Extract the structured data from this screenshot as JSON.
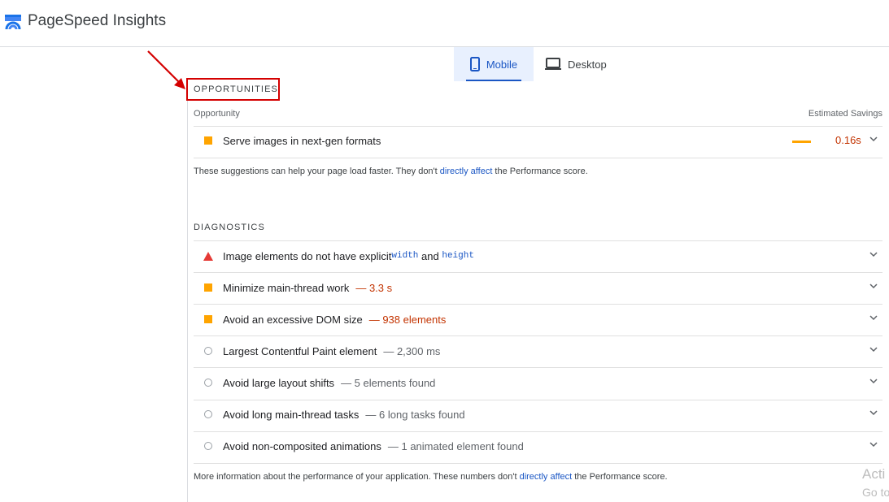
{
  "header": {
    "title": "PageSpeed Insights"
  },
  "tabs": [
    {
      "label": "Mobile"
    },
    {
      "label": "Desktop"
    }
  ],
  "opportunities": {
    "title": "OPPORTUNITIES",
    "col_left": "Opportunity",
    "col_right": "Estimated Savings",
    "items": [
      {
        "label": "Serve images in next-gen formats",
        "savings": "0.16s"
      }
    ],
    "note_before": "These suggestions can help your page load faster. They don't ",
    "note_link": "directly affect",
    "note_after": " the Performance score."
  },
  "diagnostics": {
    "title": "DIAGNOSTICS",
    "items": [
      {
        "label": "Image elements do not have explicit ",
        "code1": "width",
        "joiner": " and ",
        "code2": "height"
      },
      {
        "label": "Minimize main-thread work",
        "detail": "— 3.3 s"
      },
      {
        "label": "Avoid an excessive DOM size",
        "detail": "— 938 elements"
      },
      {
        "label": "Largest Contentful Paint element",
        "detail": "— 2,300 ms"
      },
      {
        "label": "Avoid large layout shifts",
        "detail": "— 5 elements found"
      },
      {
        "label": "Avoid long main-thread tasks",
        "detail": "— 6 long tasks found"
      },
      {
        "label": "Avoid non-composited animations",
        "detail": "— 1 animated element found"
      }
    ],
    "note_before": "More information about the performance of your application. These numbers don't ",
    "note_link": "directly affect",
    "note_after": " the Performance score."
  },
  "watermark": {
    "line1": "Acti",
    "line2": "Go to"
  },
  "colors": {
    "accent": "#1a56c4",
    "warn": "#ffa400",
    "fail": "#e53935",
    "annotation": "#d40000"
  }
}
